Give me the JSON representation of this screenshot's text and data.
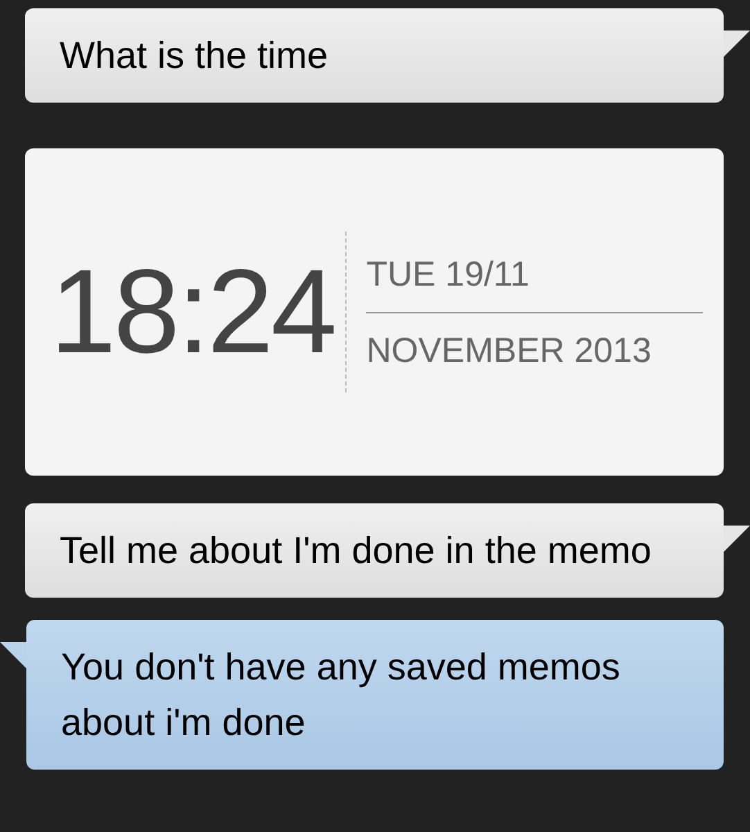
{
  "messages": [
    {
      "kind": "user",
      "text": "What is the time"
    },
    {
      "kind": "clock",
      "time": "18:24",
      "day": "TUE 19/11",
      "month_year": "NOVEMBER 2013"
    },
    {
      "kind": "user",
      "text": "Tell me about I'm done in the memo"
    },
    {
      "kind": "assistant",
      "text": "You don't have any saved memos about i'm done"
    }
  ]
}
